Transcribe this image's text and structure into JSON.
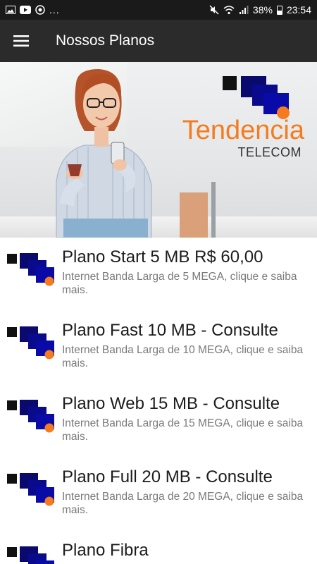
{
  "status_bar": {
    "battery": "38%",
    "time": "23:54",
    "left_icons": [
      "image-icon",
      "youtube-icon",
      "chrome-icon"
    ],
    "overflow": "..."
  },
  "app_bar": {
    "title": "Nossos Planos",
    "menu_icon": "hamburger-menu-icon"
  },
  "hero": {
    "brand_name": "Tendencia",
    "brand_sub": "TELECOM",
    "colors": {
      "orange": "#f47b20",
      "blue": "#0a0aa8",
      "navy": "#0a0a6e",
      "dark": "#111111"
    }
  },
  "plans": [
    {
      "title": "Plano Start 5 MB R$ 60,00",
      "description": "Internet Banda Larga de 5 MEGA, clique e saiba mais."
    },
    {
      "title": "Plano Fast 10 MB - Consulte",
      "description": "Internet Banda Larga de 10 MEGA, clique e saiba mais."
    },
    {
      "title": "Plano Web 15 MB - Consulte",
      "description": "Internet Banda Larga de 15 MEGA, clique e saiba mais."
    },
    {
      "title": "Plano Full 20 MB - Consulte",
      "description": "Internet Banda Larga de 20 MEGA, clique e saiba mais."
    },
    {
      "title": "Plano Fibra",
      "description": ""
    }
  ]
}
